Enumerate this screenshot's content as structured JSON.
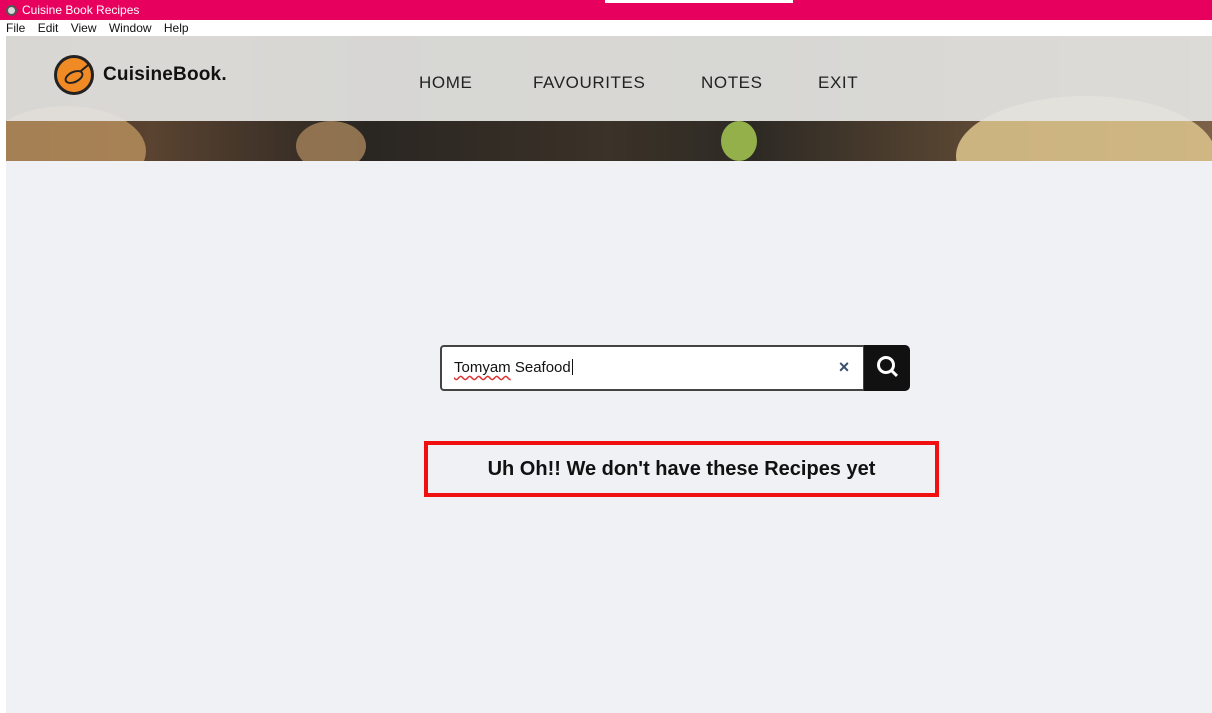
{
  "window": {
    "title": "Cuisine Book Recipes"
  },
  "menu": [
    "File",
    "Edit",
    "View",
    "Window",
    "Help"
  ],
  "brand": {
    "name": "CuisineBook."
  },
  "nav": {
    "home": "HOME",
    "favourites": "FAVOURITES",
    "notes": "NOTES",
    "exit": "EXIT"
  },
  "search": {
    "misspelled_word": "Tomyam",
    "rest": " Seafood",
    "clear_icon": "×"
  },
  "message": "Uh Oh!! We don't have these Recipes yet",
  "colors": {
    "titlebar": "#e8005e",
    "page_bg": "#f0f1f5",
    "notice_border": "#f01010",
    "search_button": "#111111",
    "logo": "#f08a24"
  }
}
